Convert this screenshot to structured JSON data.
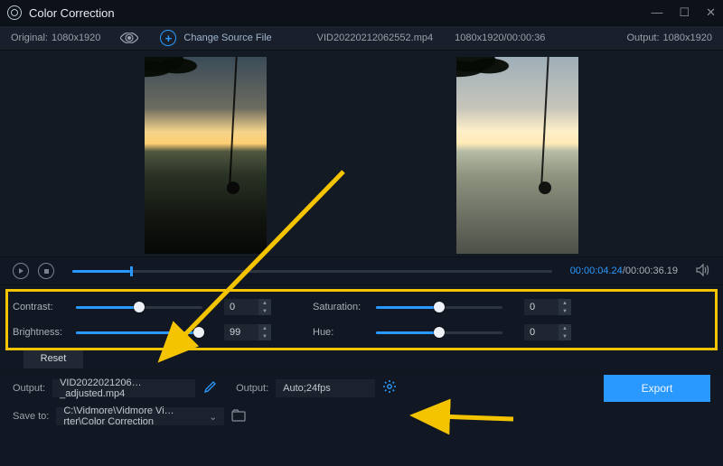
{
  "titlebar": {
    "title": "Color Correction"
  },
  "infobar": {
    "original_label": "Original:",
    "original_dim": "1080x1920",
    "change_source": "Change Source File",
    "filename": "VID20220212062552.mp4",
    "file_dim_dur": "1080x1920/00:00:36",
    "output_label": "Output:",
    "output_dim": "1080x1920"
  },
  "playback": {
    "timeline_progress_pct": 12,
    "current_time": "00:00:04.24",
    "total_time": "00:00:36.19"
  },
  "controls": {
    "contrast": {
      "label": "Contrast:",
      "value": "0",
      "pct": 50
    },
    "brightness": {
      "label": "Brightness:",
      "value": "99",
      "pct": 100
    },
    "saturation": {
      "label": "Saturation:",
      "value": "0",
      "pct": 50
    },
    "hue": {
      "label": "Hue:",
      "value": "0",
      "pct": 50
    },
    "reset": "Reset"
  },
  "footer": {
    "output_file_label": "Output:",
    "output_file": "VID2022021206…_adjusted.mp4",
    "output_fmt_label": "Output:",
    "output_fmt": "Auto;24fps",
    "save_to_label": "Save to:",
    "save_to_path": "C:\\Vidmore\\Vidmore Vi…rter\\Color Correction",
    "export": "Export"
  }
}
